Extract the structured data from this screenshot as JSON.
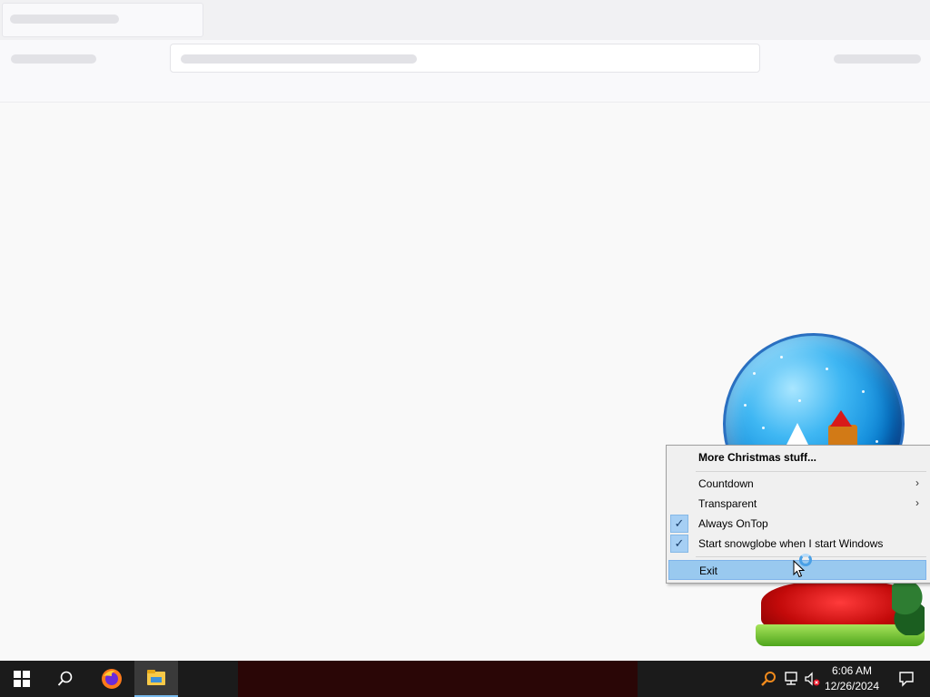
{
  "menu": {
    "items": [
      {
        "label": "More Christmas stuff...",
        "bold": true
      },
      {
        "label": "Countdown",
        "submenu": true
      },
      {
        "label": "Transparent",
        "submenu": true
      },
      {
        "label": "Always OnTop",
        "checked": true
      },
      {
        "label": "Start snowglobe when I start Windows",
        "checked": true
      },
      {
        "label": "Exit",
        "highlighted": true
      }
    ],
    "submenu_glyph": "›",
    "check_glyph": "✓"
  },
  "taskbar": {
    "start_icon": "windows-logo-icon",
    "search_icon": "search-icon",
    "pinned": [
      {
        "name": "firefox-icon"
      },
      {
        "name": "file-explorer-icon",
        "active": true
      }
    ],
    "tray": [
      "snowglobe-tray-icon",
      "network-icon",
      "volume-muted-icon"
    ],
    "clock": {
      "time": "6:06 AM",
      "date": "12/26/2024"
    },
    "notification_icon": "action-center-icon"
  },
  "colors": {
    "taskbar": "#1b1b1b",
    "menu_bg": "#f0f0f0",
    "menu_highlight": "#99c9ef",
    "check_bg": "#a6cff4"
  }
}
